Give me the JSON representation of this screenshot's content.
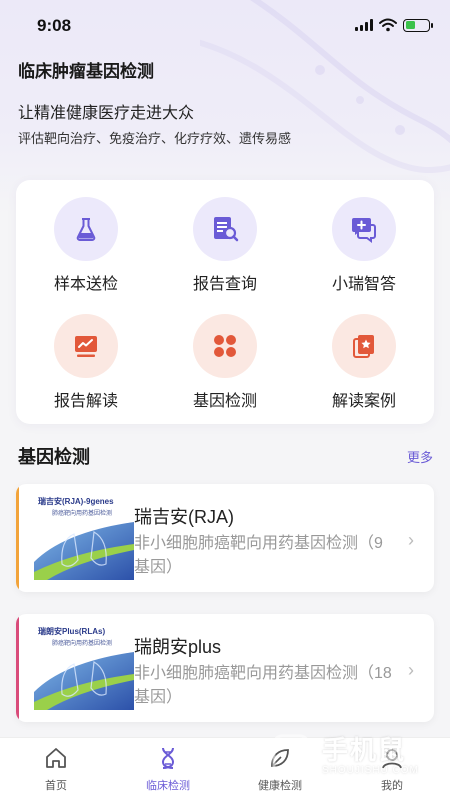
{
  "status_bar": {
    "time": "9:08"
  },
  "header": {
    "title": "临床肿瘤基因检测",
    "slogan": "让精准健康医疗走进大众",
    "sub_slogan": "评估靶向治疗、免疫治疗、化疗疗效、遗传易感"
  },
  "menu": [
    {
      "label": "样本送检",
      "icon": "flask-icon",
      "tone": "purple"
    },
    {
      "label": "报告查询",
      "icon": "report-search-icon",
      "tone": "purple"
    },
    {
      "label": "小瑞智答",
      "icon": "chat-plus-icon",
      "tone": "purple"
    },
    {
      "label": "报告解读",
      "icon": "chart-screen-icon",
      "tone": "orange"
    },
    {
      "label": "基因检测",
      "icon": "four-leaf-icon",
      "tone": "orange"
    },
    {
      "label": "解读案例",
      "icon": "star-doc-icon",
      "tone": "orange"
    }
  ],
  "section": {
    "title": "基因检测",
    "more": "更多"
  },
  "products": [
    {
      "name": "瑞吉安(RJA)",
      "desc": "非小细胞肺癌靶向用药基因检测（9 基因）",
      "thumb_title": "瑞吉安(RJA)-9genes",
      "thumb_sub": "肺癌靶向用药基因检测",
      "accent": "#f2a33a"
    },
    {
      "name": "瑞朗安plus",
      "desc": "非小细胞肺癌靶向用药基因检测（18 基因）",
      "thumb_title": "瑞朗安Plus(RLAs)",
      "thumb_sub": "肺癌靶向用药基因检测",
      "accent": "#d94b7a"
    }
  ],
  "tabs": [
    {
      "label": "首页",
      "icon": "home-icon"
    },
    {
      "label": "临床检测",
      "icon": "dna-icon"
    },
    {
      "label": "健康检测",
      "icon": "leaf-icon"
    },
    {
      "label": "我的",
      "icon": "user-icon"
    }
  ],
  "watermark": {
    "text": "手机鼠",
    "sub": "SHOUJISHU.COM"
  },
  "colors": {
    "accent": "#6a5bd6",
    "purple_bg": "#ece9fb",
    "orange_bg": "#fbe8e2",
    "orange_icon": "#e2583a"
  }
}
